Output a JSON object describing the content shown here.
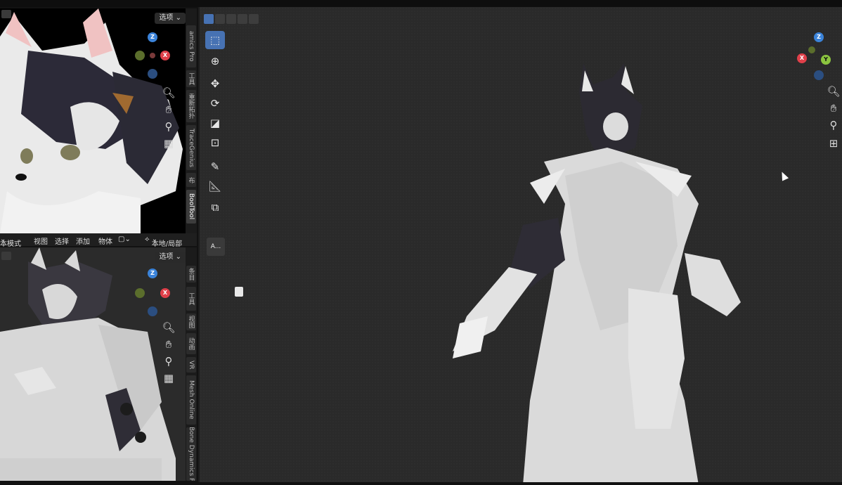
{
  "top_pane": {
    "options_label": "选项",
    "side_tabs": [
      "amics Pro",
      "工具",
      "重新拓扑",
      "TraceGenius",
      "布",
      "BoolTool"
    ]
  },
  "editor_header": {
    "mode": "本模式",
    "view": "视图",
    "select": "选择",
    "add": "添加",
    "object": "物体",
    "transform": "本地/局部"
  },
  "bottom_pane": {
    "options_label": "选项",
    "side_tabs": [
      "条目",
      "工具",
      "视图",
      "动画",
      "VR",
      "Mesh Online",
      "Bone Dynamics P"
    ]
  },
  "gizmo": {
    "x": "X",
    "y": "Y",
    "z": "Z"
  },
  "colors": {
    "x_axis": "#e0404a",
    "y_axis": "#8bc43f",
    "z_axis": "#3b83d9",
    "active_tool": "#4772b3"
  },
  "main_viewport": {
    "toolbar_icons": [
      "select-box",
      "cursor",
      "move",
      "rotate",
      "scale",
      "transform",
      "annotate",
      "measure",
      "add-cube"
    ],
    "annotation_label": "A..."
  }
}
